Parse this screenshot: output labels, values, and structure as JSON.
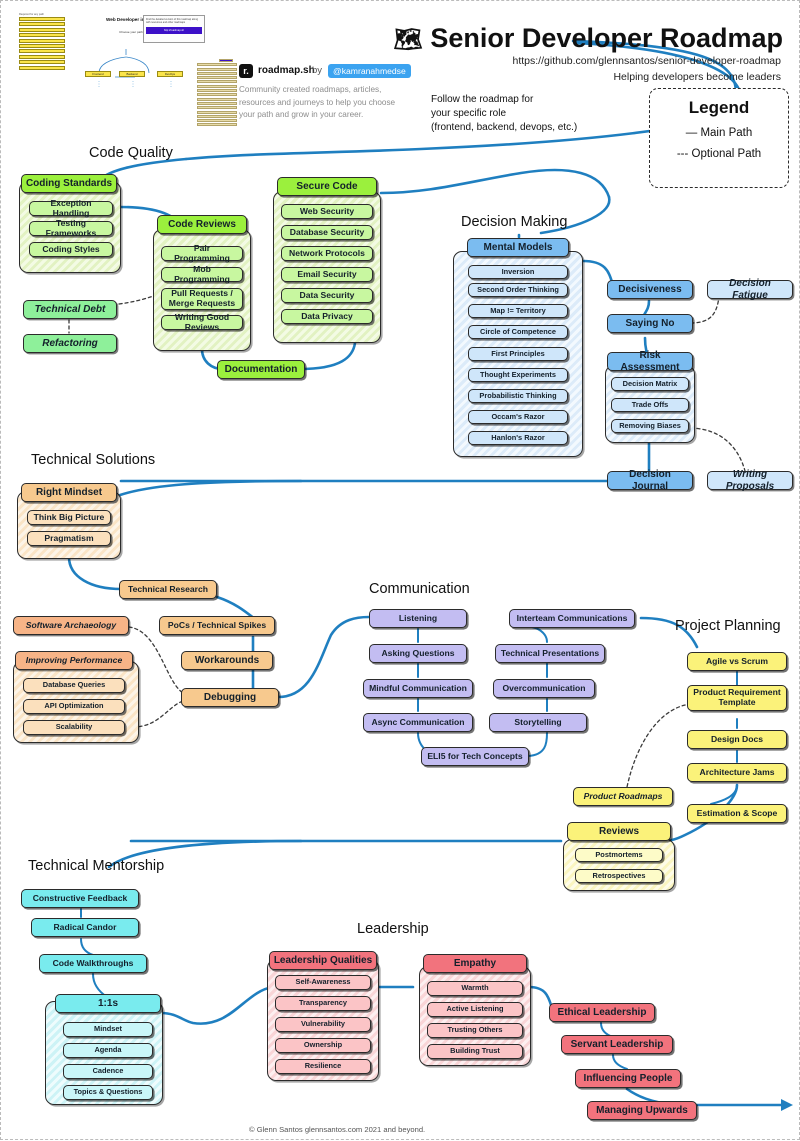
{
  "header": {
    "map_icon": "world-map-icon",
    "title": "Senior Developer Roadmap",
    "url": "https://github.com/glennsantos/senior-developer-roadmap",
    "tagline": "Helping developers become leaders",
    "follow_note": "Follow the roadmap for\nyour specific role\n(frontend, backend, devops, etc.)"
  },
  "legend": {
    "title": "Legend",
    "main_path": "— Main Path",
    "optional_path": "--- Optional Path"
  },
  "promo": {
    "logo_text": "r.",
    "name": "roadmap.sh",
    "by": "by",
    "handle": "@kamranahmedse",
    "description": "Community created roadmaps, articles, resources and journeys to help you choose your path and grow in your career."
  },
  "thumbnails": {
    "list_caption": "Required for any path",
    "list_items": [
      "Git - Version Control",
      "Basic Terminal Usage",
      "Data Structures & Algorithms",
      "HTTP",
      "Licenses",
      "Networks / Networking",
      "Learn",
      "Atomization & Dev Ops",
      "Design Patterns",
      "Character Knowledge"
    ],
    "flow_title": "Web Developer in 2021",
    "flow_sub": "Choose your path",
    "flow_nodes": [
      "Frontend",
      "Backend",
      "DevOps"
    ],
    "card_text": "Find the detailed version of this roadmap along with resources and other roadmaps",
    "card_button": "http://roadmap.sh"
  },
  "footer": "© Glenn Santos glennsantos.com 2021 and beyond.",
  "sections": [
    {
      "name": "Code Quality",
      "label": "Code Quality"
    },
    {
      "name": "Decision Making",
      "label": "Decision Making"
    },
    {
      "name": "Technical Solutions",
      "label": "Technical Solutions"
    },
    {
      "name": "Communication",
      "label": "Communication"
    },
    {
      "name": "Project Planning",
      "label": "Project Planning"
    },
    {
      "name": "Technical Mentorship",
      "label": "Technical Mentorship"
    },
    {
      "name": "Leadership",
      "label": "Leadership"
    }
  ],
  "code_quality": {
    "coding_standards": {
      "title": "Coding Standards",
      "children": [
        "Exception Handling",
        "Testing Frameworks",
        "Coding Styles"
      ]
    },
    "code_reviews": {
      "title": "Code Reviews",
      "children": [
        "Pair Programming",
        "Mob Programming",
        "Pull Requests /\nMerge Requests",
        "Writing Good Reviews"
      ]
    },
    "secure_code": {
      "title": "Secure Code",
      "children": [
        "Web Security",
        "Database Security",
        "Network Protocols",
        "Email Security",
        "Data Security",
        "Data Privacy"
      ]
    },
    "technical_debt": "Technical Debt",
    "refactoring": "Refactoring",
    "documentation": "Documentation"
  },
  "decision_making": {
    "mental_models": {
      "title": "Mental Models",
      "children": [
        "Inversion",
        "Second Order Thinking",
        "Map != Territory",
        "Circle of Competence",
        "First Principles",
        "Thought Experiments",
        "Probabilistic Thinking",
        "Occam's Razor",
        "Hanlon's Razor"
      ]
    },
    "decisiveness": "Decisiveness",
    "saying_no": "Saying No",
    "decision_fatigue": "Decision Fatigue",
    "risk_assessment": {
      "title": "Risk Assessment",
      "children": [
        "Decision Matrix",
        "Trade Offs",
        "Removing Biases"
      ]
    },
    "decision_journal": "Decision Journal",
    "writing_proposals": "Writing Proposals"
  },
  "technical_solutions": {
    "right_mindset": {
      "title": "Right Mindset",
      "children": [
        "Think Big Picture",
        "Pragmatism"
      ]
    },
    "technical_research": "Technical Research",
    "software_archaeology": "Software Archaeology",
    "pocs": "PoCs / Technical Spikes",
    "improving_performance": {
      "title": "Improving Performance",
      "children": [
        "Database Queries",
        "API Optimization",
        "Scalability"
      ]
    },
    "workarounds": "Workarounds",
    "debugging": "Debugging"
  },
  "communication": {
    "left_chain": [
      "Listening",
      "Asking Questions",
      "Mindful Communication",
      "Async Communication"
    ],
    "right_chain": [
      "Interteam Communications",
      "Technical Presentations",
      "Overcommunication",
      "Storytelling"
    ],
    "eli5": "ELI5 for Tech Concepts"
  },
  "project_planning": {
    "chain": [
      "Agile vs Scrum",
      "Product Requirement\nTemplate",
      "Design Docs",
      "Architecture Jams",
      "Estimation & Scope"
    ],
    "product_roadmaps": "Product Roadmaps",
    "reviews": {
      "title": "Reviews",
      "children": [
        "Postmortems",
        "Retrospectives"
      ]
    }
  },
  "technical_mentorship": {
    "chain": [
      "Constructive Feedback",
      "Radical Candor",
      "Code Walkthroughs"
    ],
    "one_on_ones": {
      "title": "1:1s",
      "children": [
        "Mindset",
        "Agenda",
        "Cadence",
        "Topics & Questions"
      ]
    }
  },
  "leadership": {
    "leadership_qualities": {
      "title": "Leadership Qualities",
      "children": [
        "Self-Awareness",
        "Transparency",
        "Vulnerability",
        "Ownership",
        "Resilience"
      ]
    },
    "empathy": {
      "title": "Empathy",
      "children": [
        "Warmth",
        "Active Listening",
        "Trusting Others",
        "Building Trust"
      ]
    },
    "chain": [
      "Ethical Leadership",
      "Servant Leadership",
      "Influencing People",
      "Managing Upwards"
    ]
  },
  "colors": {
    "path_main": "#1f7fc0",
    "path_optional": "#3a3a3a",
    "code_quality": "#9bf03d",
    "decision_making": "#7bbcf0",
    "technical_solutions": "#f7c98e",
    "communication": "#c3bdf2",
    "project_planning": "#fbf27a",
    "technical_mentorship": "#79ebee",
    "leadership": "#f2737d"
  }
}
